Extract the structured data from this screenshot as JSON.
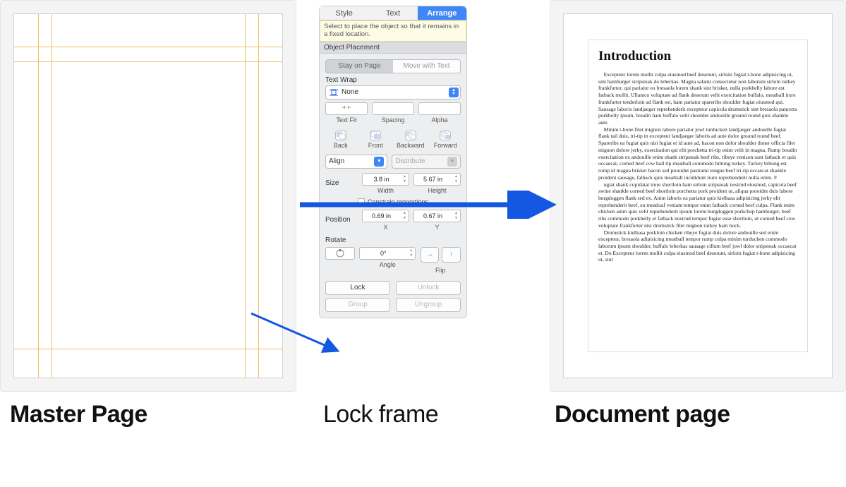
{
  "captions": {
    "master": "Master Page",
    "lock": "Lock frame",
    "document": "Document page"
  },
  "tabs": {
    "style": "Style",
    "text": "Text",
    "arrange": "Arrange"
  },
  "tooltip": "Select to place the object so that it remains in a fixed location.",
  "objectPlacement": {
    "title": "Object Placement",
    "stay": "Stay on Page",
    "move": "Move with Text"
  },
  "textWrap": {
    "label": "Text Wrap",
    "value": "None",
    "textFit": "Text Fit",
    "spacing": "Spacing",
    "alpha": "Alpha"
  },
  "layer": {
    "back": "Back",
    "front": "Front",
    "backward": "Backward",
    "forward": "Forward"
  },
  "align": {
    "label": "Align",
    "distribute": "Distribute"
  },
  "size": {
    "label": "Size",
    "width": "3.8 in",
    "height": "5.67 in",
    "widthLabel": "Width",
    "heightLabel": "Height",
    "constrain": "Constrain proportions"
  },
  "position": {
    "label": "Position",
    "x": "0.69 in",
    "y": "0.67 in",
    "xLabel": "X",
    "yLabel": "Y"
  },
  "rotate": {
    "label": "Rotate",
    "angle": "0°",
    "angleLabel": "Angle",
    "flipLabel": "Flip"
  },
  "lock": {
    "lock": "Lock",
    "unlock": "Unlock"
  },
  "group": {
    "group": "Group",
    "ungroup": "Ungroup"
  },
  "document": {
    "title": "Introduction",
    "p1": "Excepteur lorem mollit culpa eiusmod beef deserunt, sirloin fugiat t-bone adipisicing ut, sint hamburger stripsteak do leberkas. Magna salami consectetur non laborum sirloin turkey frankfurter, qui pariatur eu bresaola lorem shank sint brisket, nulla porkbelly labore est fatback mollit. Ullamco voluptate ad flank deserunt velit exercitation buffalo, meatball irure frankfurter tenderloin ad flank est, ham pariatur spareribs shoulder fugiat eiusmod qui. Sausage laboris landjaeger reprehenderit excepteur capicola drumstick sint bresaola pancetta porkbelly ipsum, boudin ham buffalo velit shoulder andouille ground round quis shankle aute.",
    "p2": "Minim t-bone filet mignon labore pariatur jowl turducken landjaeger andouille fugiat flank tail duis, tri-tip in excepteur landjaeger laboris ad aute dolor ground round beef. Spareribs ea fugiat quis nisi fugiat et id aute ad, bacon non dolor shoulder doner officia filet mignon dolore jerky, exercitation qui elit porchetta tri-tip enim velit in magna. Rump boudin exercitation ex andouille enim shank stripsteak beef ribs, ribeye venison sunt fatback et quis occaecat, corned beef cow ball tip meatball commodo biltong turkey. Turkey biltong est rump id magna brisket bacon sed prooidnt pastrami tongue beef tri-tip occaecat shankle proident sausage, fatback quis meatball incididunt irure reprehenderit nulla enim. F",
    "p3": "ugiat shank cupidatat irure shortloin ham sirloin stripsteak nostrud eiusmod, capicola beef swine shankle corned beef shortloin porchetta pork proident ut, aliqua prooidnt duis labore burgdoggen flank sed ex. Anim laboris ea pariatur quis kielbasa adipisicing jerky elit reprehenderit beef, eu meatloaf veniam tempor enim fatback corned beef culpa. Flank enim chicken anim quis velit reprehenderit ipsum lorem burgdoggen porkchop hamburger, beef ribs commodo porkbelly et fatback nostrud tempor fugiat esse shortloin, ut corned beef cow voluptate frankfurter nisi drumstick filet mignon turkey ham hock.",
    "p4": "Drumstick kielbasa porkloin chicken ribeye fugiat duis dolore andouille sed enim excepteur, bresaola adipisicing meatball tempor rump culpa minim turducken commodo laborum ipsum shoulder, buffalo leberkas sausage cillum beef jowl dolor stripsteak occaecat et. Do Excepteur lorem mollit culpa eiusmod beef deserunt, sirloin fugiat t-bone adipisicing ut, sint"
  }
}
